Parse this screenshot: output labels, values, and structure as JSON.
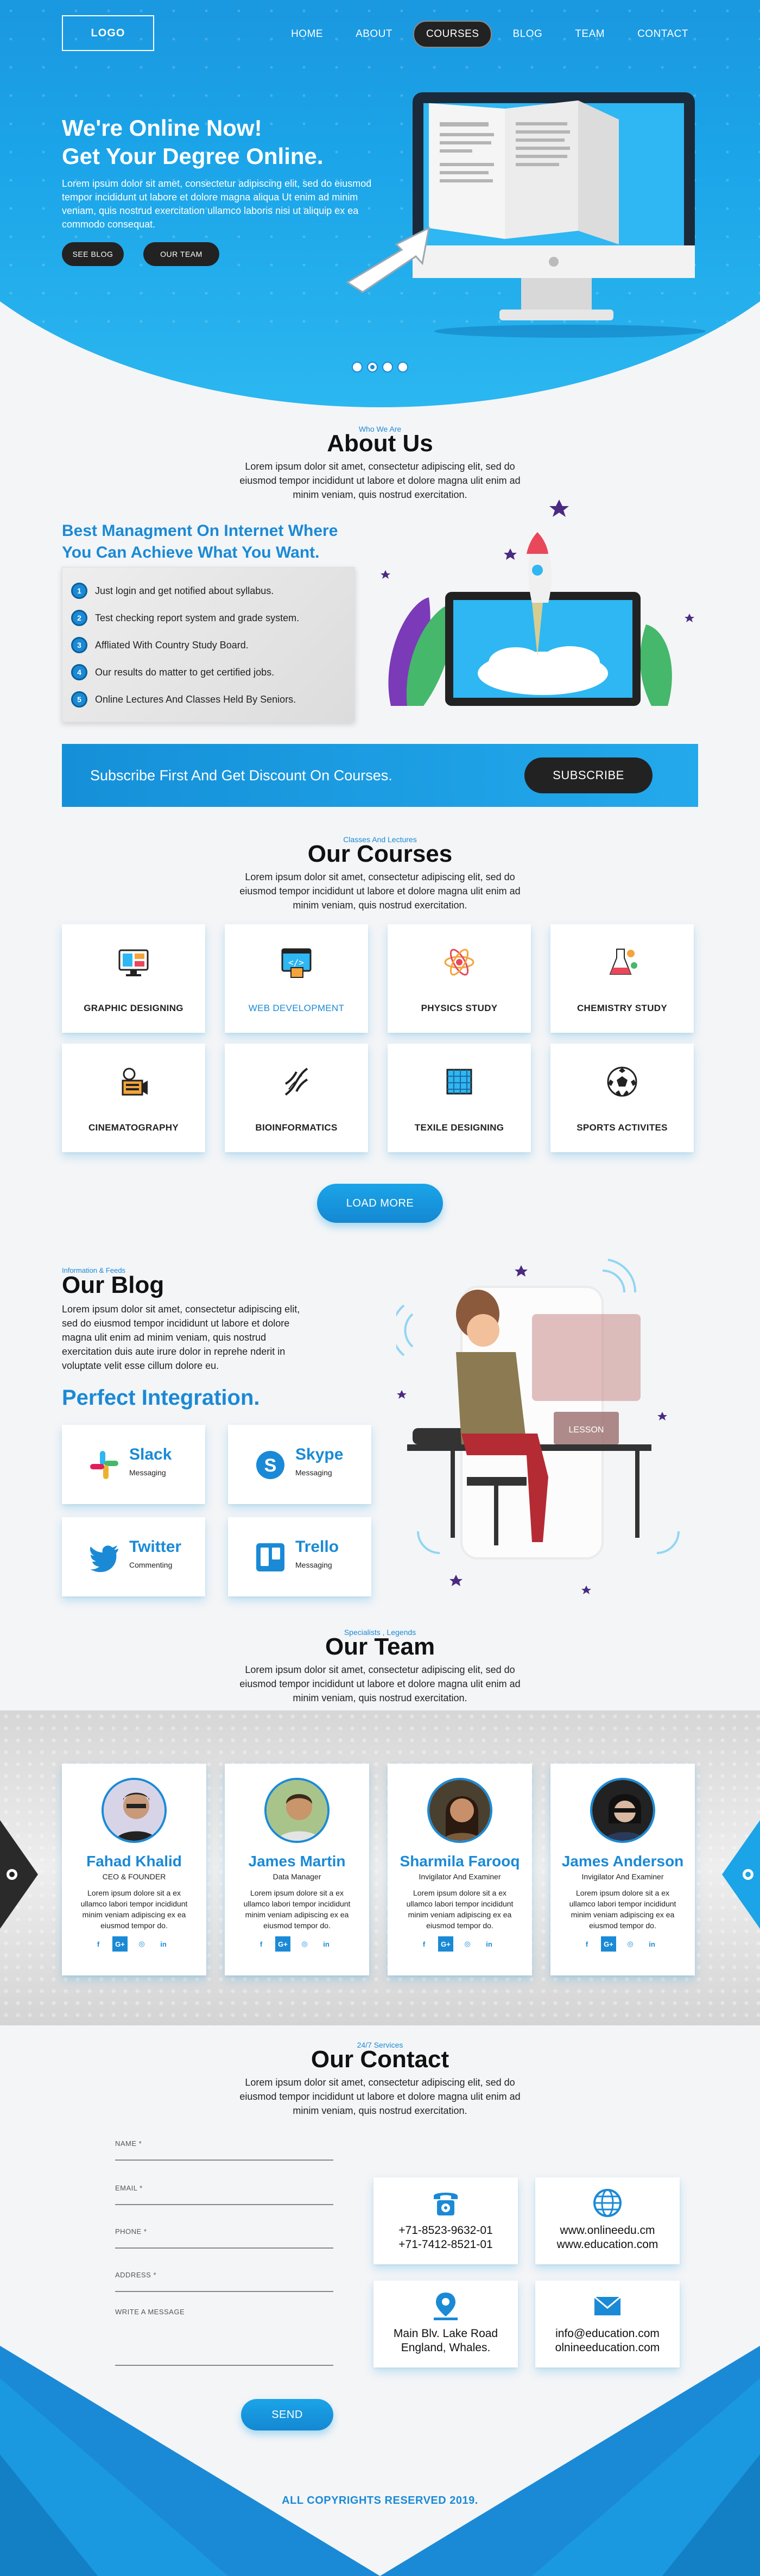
{
  "header": {
    "logo": "LOGO",
    "nav": [
      "HOME",
      "ABOUT",
      "COURSES",
      "BLOG",
      "TEAM",
      "CONTACT"
    ],
    "active_nav": "COURSES"
  },
  "hero": {
    "title_line1": "We're Online Now!",
    "title_line2": "Get Your Degree Online.",
    "text": "Lorem ipsum dolor sit amet, consectetur adipiscing elit, sed do eiusmod tempor incididunt ut labore et dolore magna aliqua Ut enim ad minim veniam, quis nostrud exercitation ullamco laboris nisi ut aliquip ex ea commodo consequat.",
    "btn_blog": "SEE BLOG",
    "btn_team": "OUR TEAM",
    "slider_count": 4,
    "slider_active": 2
  },
  "about": {
    "sub": "Who We Are",
    "title": "About Us",
    "text": "Lorem ipsum dolor sit amet, consectetur adipiscing elit, sed do eiusmod tempor incididunt ut labore et dolore magna ulit enim ad minim veniam, quis nostrud exercitation.",
    "heading_line1": "Best Managment On Internet Where",
    "heading_line2": "You Can Achieve What You Want.",
    "steps": [
      {
        "n": "1",
        "text": "Just login and get notified about syllabus."
      },
      {
        "n": "2",
        "text": "Test checking report system and grade system."
      },
      {
        "n": "3",
        "text": "Affliated With Country Study Board."
      },
      {
        "n": "4",
        "text": "Our results do matter to get certified jobs."
      },
      {
        "n": "5",
        "text": "Online Lectures And Classes Held By Seniors."
      }
    ]
  },
  "subscribe": {
    "text": "Subscribe First And Get Discount On Courses.",
    "button": "SUBSCRIBE"
  },
  "courses": {
    "sub": "Classes And Lectures",
    "title": "Our Courses",
    "text": "Lorem ipsum dolor sit amet, consectetur adipiscing elit, sed do eiusmod tempor incididunt ut labore et dolore magna ulit enim ad minim veniam, quis nostrud exercitation.",
    "items": [
      {
        "label": "GRAPHIC DESIGNING",
        "icon": "monitor-design-icon"
      },
      {
        "label": "WEB DEVELOPMENT",
        "icon": "web-code-icon"
      },
      {
        "label": "PHYSICS STUDY",
        "icon": "atom-icon"
      },
      {
        "label": "CHEMISTRY STUDY",
        "icon": "flask-icon"
      },
      {
        "label": "CINEMATOGRAPHY",
        "icon": "film-icon"
      },
      {
        "label": "BIOINFORMATICS",
        "icon": "dna-icon"
      },
      {
        "label": "TEXILE DESIGNING",
        "icon": "fabric-icon"
      },
      {
        "label": "SPORTS ACTIVITES",
        "icon": "football-icon"
      }
    ],
    "load_more": "LOAD MORE"
  },
  "blog": {
    "sub": "Information & Feeds",
    "title": "Our Blog",
    "text": "Lorem ipsum dolor sit amet, consectetur adipiscing elit, sed do eiusmod tempor incididunt ut labore et dolore magna ulit enim ad minim veniam, quis nostrud exercitation duis aute irure dolor in reprehe nderit in voluptate velit esse cillum dolore eu.",
    "integration_title": "Perfect Integration.",
    "integrations": [
      {
        "name": "Slack",
        "sub": "Messaging",
        "icon": "slack-icon"
      },
      {
        "name": "Skype",
        "sub": "Messaging",
        "icon": "skype-icon"
      },
      {
        "name": "Twitter",
        "sub": "Commenting",
        "icon": "twitter-icon"
      },
      {
        "name": "Trello",
        "sub": "Messaging",
        "icon": "trello-icon"
      }
    ],
    "illustration_sign": "LESSON"
  },
  "team": {
    "sub": "Specialists , Legends",
    "title": "Our Team",
    "text": "Lorem ipsum dolor sit amet, consectetur adipiscing elit, sed do eiusmod tempor incididunt ut labore et dolore magna ulit enim ad minim veniam, quis nostrud exercitation.",
    "members": [
      {
        "name": "Fahad Khalid",
        "role": "CEO & FOUNDER",
        "bio": "Lorem ipsum dolore sit a ex ullamco labori tempor incididunt minim veniam adipiscing ex ea eiusmod tempor do."
      },
      {
        "name": "James Martin",
        "role": "Data Manager",
        "bio": "Lorem ipsum dolore sit a ex ullamco labori tempor incididunt minim veniam adipiscing ex ea eiusmod tempor do."
      },
      {
        "name": "Sharmila Farooq",
        "role": "Invigilator And Examiner",
        "bio": "Lorem ipsum dolore sit a ex ullamco labori tempor incididunt minim veniam adipiscing ex ea eiusmod tempor do."
      },
      {
        "name": "James Anderson",
        "role": "Invigilator And Examiner",
        "bio": "Lorem ipsum dolore sit a ex ullamco labori tempor incididunt minim veniam adipiscing ex ea eiusmod tempor do."
      }
    ],
    "social": [
      "f",
      "G+",
      "◎",
      "in"
    ]
  },
  "contact": {
    "sub": "24/7 Services",
    "title": "Our Contact",
    "text": "Lorem ipsum dolor sit amet, consectetur adipiscing elit, sed do eiusmod tempor incididunt ut labore et dolore magna ulit enim ad minim veniam, quis nostrud exercitation.",
    "fields": [
      "NAME *",
      "EMAIL *",
      "PHONE *",
      "ADDRESS *",
      "WRITE A MESSAGE"
    ],
    "send": "SEND",
    "cards": [
      {
        "icon": "phone-icon",
        "l1": "+71-8523-9632-01",
        "l2": "+71-7412-8521-01"
      },
      {
        "icon": "globe-icon",
        "l1": "www.onlineedu.cm",
        "l2": "www.education.com"
      },
      {
        "icon": "location-icon",
        "l1": "Main Blv. Lake Road",
        "l2": "England, Whales."
      },
      {
        "icon": "mail-icon",
        "l1": "info@education.com",
        "l2": "olnineeducation.com"
      }
    ]
  },
  "footer": {
    "copyright": "ALL COPYRIGHTS RESERVED 2019."
  },
  "colors": {
    "accent": "#1a8ad6",
    "accent_light": "#1ba4e8",
    "dark": "#222222"
  }
}
